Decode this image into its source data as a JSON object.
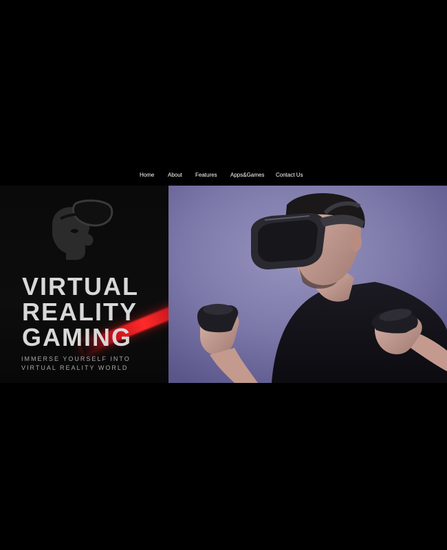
{
  "nav": {
    "items": [
      {
        "label": "Home"
      },
      {
        "label": "About"
      },
      {
        "label": "Features"
      },
      {
        "label": "Apps&Games"
      },
      {
        "label": "Contact Us"
      }
    ]
  },
  "hero": {
    "title_lines": [
      "VIRTUAL",
      "REALITY",
      "GAMING"
    ],
    "subtitle_lines": [
      "IMMERSE YOURSELF INTO",
      "VIRTUAL REALITY WORLD"
    ],
    "logo_icon": "vr-headset-head-icon",
    "photo_subject": "man-wearing-vr-headset-photo",
    "colors": {
      "background": "#000000",
      "title": "#d8d8d8",
      "subtitle": "#a9a9a9",
      "accent_red": "#ff2a2a",
      "photo_backdrop": "#7a76a6"
    }
  }
}
